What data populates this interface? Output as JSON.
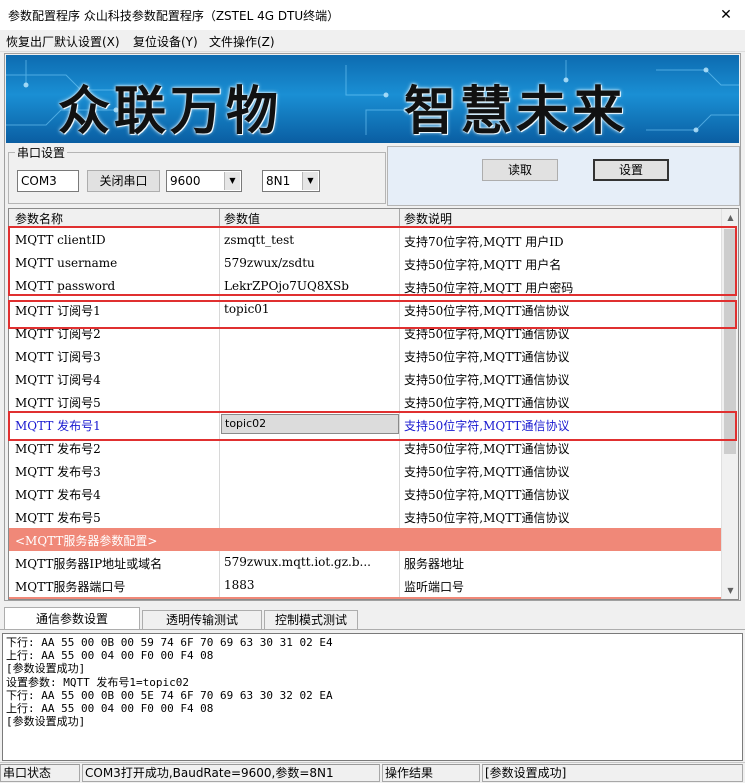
{
  "window": {
    "title": "参数配置程序 众山科技参数配置程序（ZSTEL 4G DTU终端）",
    "close_glyph": "✕"
  },
  "menu": [
    {
      "label": "恢复出厂默认设置(X)"
    },
    {
      "label": "复位设备(Y)"
    },
    {
      "label": "文件操作(Z)"
    }
  ],
  "banner": {
    "left_text": "众联万物",
    "right_text": "智慧未来"
  },
  "serial": {
    "group_label": "串口设置",
    "port": "COM3",
    "close_port_button": "关闭串口",
    "baud_rate": "9600",
    "frame_format": "8N1"
  },
  "actions": {
    "read_button": "读取",
    "set_button": "设置"
  },
  "grid": {
    "headers": [
      "参数名称",
      "参数值",
      "参数说明"
    ],
    "rows": [
      {
        "name": "MQTT clientID",
        "value": "zsmqtt_test",
        "desc": "支持70位字符,MQTT 用户ID"
      },
      {
        "name": "MQTT username",
        "value": "579zwux/zsdtu",
        "desc": "支持50位字符,MQTT 用户名"
      },
      {
        "name": "MQTT password",
        "value": "LekrZPOjo7UQ8XSb",
        "desc": "支持50位字符,MQTT 用户密码"
      },
      {
        "name": "MQTT 订阅号1",
        "value": "topic01",
        "desc": "支持50位字符,MQTT通信协议"
      },
      {
        "name": "MQTT 订阅号2",
        "value": "",
        "desc": "支持50位字符,MQTT通信协议"
      },
      {
        "name": "MQTT 订阅号3",
        "value": "",
        "desc": "支持50位字符,MQTT通信协议"
      },
      {
        "name": "MQTT 订阅号4",
        "value": "",
        "desc": "支持50位字符,MQTT通信协议"
      },
      {
        "name": "MQTT 订阅号5",
        "value": "",
        "desc": "支持50位字符,MQTT通信协议"
      },
      {
        "name": "MQTT 发布号1",
        "value": "topic02",
        "desc": "支持50位字符,MQTT通信协议"
      },
      {
        "name": "MQTT 发布号2",
        "value": "",
        "desc": "支持50位字符,MQTT通信协议"
      },
      {
        "name": "MQTT 发布号3",
        "value": "",
        "desc": "支持50位字符,MQTT通信协议"
      },
      {
        "name": "MQTT 发布号4",
        "value": "",
        "desc": "支持50位字符,MQTT通信协议"
      },
      {
        "name": "MQTT 发布号5",
        "value": "",
        "desc": "支持50位字符,MQTT通信协议"
      },
      {
        "name": "<MQTT服务器参数配置>",
        "value": "",
        "desc": ""
      },
      {
        "name": "MQTT服务器IP地址或域名",
        "value": "579zwux.mqtt.iot.gz.b...",
        "desc": "服务器地址"
      },
      {
        "name": "MQTT服务器端口号",
        "value": "1883",
        "desc": "监听端口号"
      }
    ]
  },
  "tabs": [
    {
      "label": "通信参数设置"
    },
    {
      "label": "透明传输测试"
    },
    {
      "label": "控制模式测试"
    }
  ],
  "log": {
    "text": "下行: AA 55 00 0B 00 59 74 6F 70 69 63 30 31 02 E4\n上行: AA 55 00 04 00 F0 00 F4 08\n[参数设置成功]\n设置参数: MQTT 发布号1=topic02\n下行: AA 55 00 0B 00 5E 74 6F 70 69 63 30 32 02 EA\n上行: AA 55 00 04 00 F0 00 F4 08\n[参数设置成功]"
  },
  "status": {
    "port_label": "串口状态",
    "port_value": "COM3打开成功,BaudRate=9600,参数=8N1",
    "op_label": "操作结果",
    "op_value": "[参数设置成功]"
  },
  "colors": {
    "section_row": "#f08878",
    "highlight_box": "#e03030",
    "selected_text": "#1a1ad0"
  }
}
